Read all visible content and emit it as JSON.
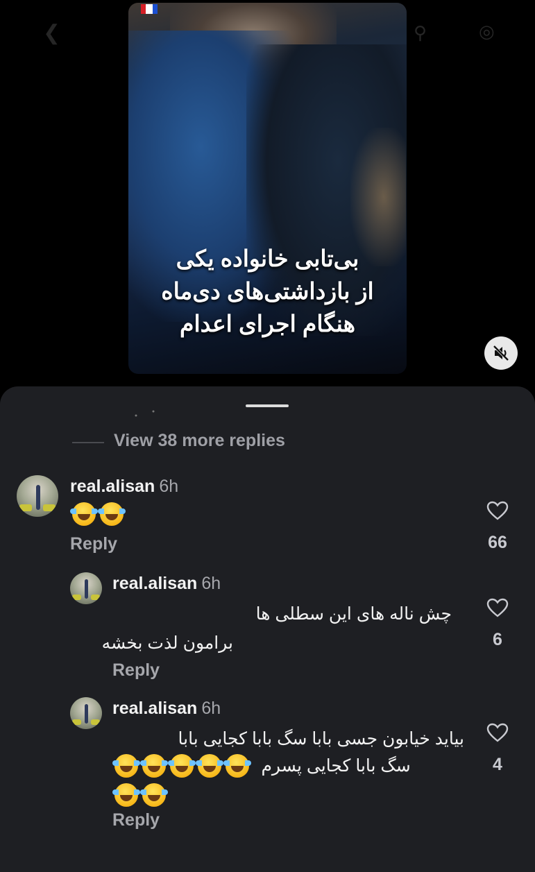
{
  "video": {
    "caption_lines": [
      "بی‌تابی خانواده یکی",
      "از بازداشتی‌های دی‌ماه",
      "هنگام اجرای اعدام"
    ],
    "mute_icon": "speaker-muted-icon"
  },
  "comments_sheet": {
    "view_more_replies": "View 38 more replies",
    "comments": [
      {
        "username": "real.alisan",
        "time": "6h",
        "emoji_count": 2,
        "text_lines": [],
        "reply_label": "Reply",
        "likes": "66"
      },
      {
        "username": "real.alisan",
        "time": "6h",
        "emoji_count": 0,
        "text_lines": [
          "چش ناله های این سطلی ها",
          "برامون لذت بخشه"
        ],
        "reply_label": "Reply",
        "likes": "6"
      },
      {
        "username": "real.alisan",
        "time": "6h",
        "text_lines": [
          "بیاید خیابون جسی بابا سگ بابا کجایی بابا",
          "سگ بابا کجایی پسرم"
        ],
        "line2_emoji_count": 5,
        "line3_emoji_count": 2,
        "reply_label": "Reply",
        "likes": "4"
      }
    ]
  }
}
